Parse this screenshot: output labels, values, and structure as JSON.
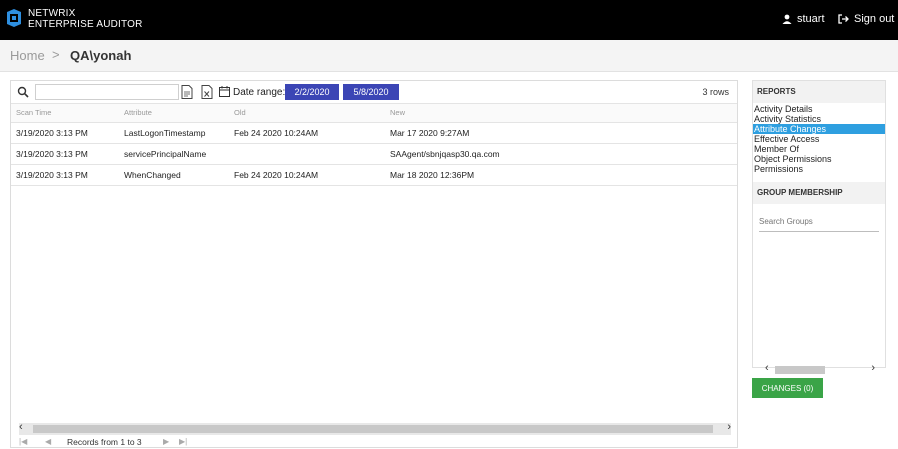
{
  "header": {
    "brand_line1": "NETWRIX",
    "brand_line2": "ENTERPRISE AUDITOR",
    "user_name": "stuart",
    "signout_label": "Sign out"
  },
  "breadcrumb": {
    "home": "Home",
    "separator": ">",
    "current": "QA\\yonah"
  },
  "toolbar": {
    "search_value": "",
    "date_range_label": "Date range:",
    "date_from": "2/2/2020",
    "date_to": "5/8/2020",
    "row_count": "3 rows"
  },
  "grid": {
    "columns": [
      "Scan Time",
      "Attribute",
      "Old",
      "New"
    ],
    "rows": [
      [
        "3/19/2020 3:13 PM",
        "LastLogonTimestamp",
        "Feb 24 2020 10:24AM",
        "Mar 17 2020 9:27AM"
      ],
      [
        "3/19/2020 3:13 PM",
        "servicePrincipalName",
        "",
        "SAAgent/sbnjqasp30.qa.com"
      ],
      [
        "3/19/2020 3:13 PM",
        "WhenChanged",
        "Feb 24 2020 10:24AM",
        "Mar 18 2020 12:36PM"
      ]
    ]
  },
  "pager": {
    "first": "|◀",
    "prev": "◀",
    "records": "Records from 1 to 3",
    "next": "▶",
    "last": "▶|"
  },
  "side": {
    "reports_title": "REPORTS",
    "reports": [
      "Activity Details",
      "Activity Statistics",
      "Attribute Changes",
      "Effective Access",
      "Member Of",
      "Object Permissions",
      "Permissions"
    ],
    "active_report": "Attribute Changes",
    "group_title": "GROUP MEMBERSHIP",
    "group_search_placeholder": "Search Groups"
  },
  "changes_button": "CHANGES (0)",
  "colors": {
    "topbar": "#000000",
    "logo": "#2e8fe0",
    "date_button": "#3b45b5",
    "active_report": "#2e9fe0",
    "changes_button": "#3aa447"
  }
}
